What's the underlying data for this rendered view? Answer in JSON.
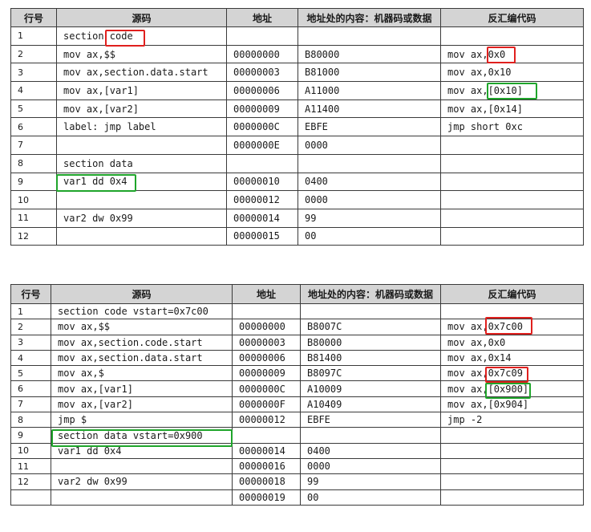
{
  "colors": {
    "red_highlight": "#e0201e",
    "green_highlight": "#1fa52b",
    "header_bg": "#d4d4d4"
  },
  "table1": {
    "headers": [
      "行号",
      "源码",
      "地址",
      "地址处的内容：机器码或数据",
      "反汇编代码"
    ],
    "rows": [
      [
        "1",
        "section code",
        "",
        "",
        ""
      ],
      [
        "2",
        "mov ax,$$",
        "00000000",
        "B80000",
        "mov ax,0x0"
      ],
      [
        "3",
        "mov ax,section.data.start",
        "00000003",
        "B81000",
        "mov ax,0x10"
      ],
      [
        "4",
        "mov ax,[var1]",
        "00000006",
        "A11000",
        "mov ax,[0x10]"
      ],
      [
        "5",
        "mov ax,[var2]",
        "00000009",
        "A11400",
        "mov ax,[0x14]"
      ],
      [
        "6",
        "label: jmp label",
        "0000000C",
        "EBFE",
        "jmp short 0xc"
      ],
      [
        "7",
        "",
        "0000000E",
        "0000",
        ""
      ],
      [
        "8",
        "section data",
        "",
        "",
        ""
      ],
      [
        "9",
        "var1 dd 0x4",
        "00000010",
        "0400",
        ""
      ],
      [
        "10",
        "",
        "00000012",
        "0000",
        ""
      ],
      [
        "11",
        "var2 dw 0x99",
        "00000014",
        "99",
        ""
      ],
      [
        "12",
        "",
        "00000015",
        "00",
        ""
      ]
    ]
  },
  "table2": {
    "headers": [
      "行号",
      "源码",
      "地址",
      "地址处的内容：机器码或数据",
      "反汇编代码"
    ],
    "rows": [
      [
        "1",
        "section code vstart=0x7c00",
        "",
        "",
        ""
      ],
      [
        "2",
        "mov ax,$$",
        "00000000",
        "B8007C",
        "mov ax,0x7c00"
      ],
      [
        "3",
        "mov ax,section.code.start",
        "00000003",
        "B80000",
        "mov ax,0x0"
      ],
      [
        "4",
        "mov ax,section.data.start",
        "00000006",
        "B81400",
        "mov ax,0x14"
      ],
      [
        "5",
        "mov ax,$",
        "00000009",
        "B8097C",
        "mov ax,0x7c09"
      ],
      [
        "6",
        "mov ax,[var1]",
        "0000000C",
        "A10009",
        "mov ax,[0x900]"
      ],
      [
        "7",
        "mov ax,[var2]",
        "0000000F",
        "A10409",
        "mov ax,[0x904]"
      ],
      [
        "8",
        "jmp $",
        "00000012",
        "EBFE",
        "jmp -2"
      ],
      [
        "9",
        "section data vstart=0x900",
        "",
        "",
        ""
      ],
      [
        "10",
        "var1 dd 0x4",
        "00000014",
        "0400",
        ""
      ],
      [
        "11",
        "",
        "00000016",
        "0000",
        ""
      ],
      [
        "12",
        "var2 dw 0x99",
        "00000018",
        "99",
        ""
      ],
      [
        "",
        "",
        "00000019",
        "00",
        ""
      ]
    ]
  }
}
